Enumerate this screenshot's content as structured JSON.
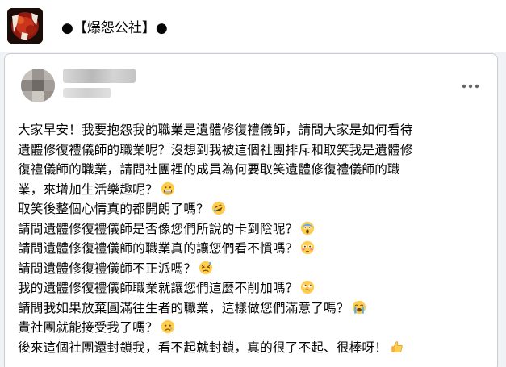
{
  "header": {
    "group_title": "●【爆怨公社】●",
    "logo_icon": "group-logo-icon"
  },
  "post": {
    "menu_icon": "more-options-icon",
    "paragraph": [
      "大家早安！我要抱怨我的職業是遺體修復禮儀師，請問大家是如何看待",
      "遺體修復禮儀師的職業呢？沒想到我被這個社團排斥和取笑我是遺體修",
      "復禮儀師的職業，請問社團裡的成員為何要取笑遺體修復禮儀師的職",
      "業，來增加生活樂趣呢？"
    ],
    "lines": [
      "取笑後整個心情真的都開朗了嗎？",
      "請問遺體修復禮儀師是否像您們所說的卡到陰呢？",
      "請問遺體修復禮儀師的職業真的讓您們看不慣嗎？",
      "請問遺體修復禮儀師不正派嗎？",
      "我的遺體修復禮儀師職業就讓您們這麼不削加嗎？",
      "請問我如果放棄圓滿往生者的職業，這樣做您們滿意了嗎？",
      "貴社團就能接受我了嗎？",
      "後來這個社團還封鎖我，看不起就封鎖，真的很了不起、很棒呀！"
    ],
    "emojis": {
      "p4": "grimace-emoji",
      "l1": "rofl-emoji",
      "l2": "scream-emoji",
      "l3": "flushed-emoji",
      "l4": "persevere-emoji",
      "l5": "eye-roll-emoji",
      "l6": "loud-cry-emoji",
      "l7": "cry-emoji",
      "l8": "thumbs-up-emoji"
    }
  }
}
